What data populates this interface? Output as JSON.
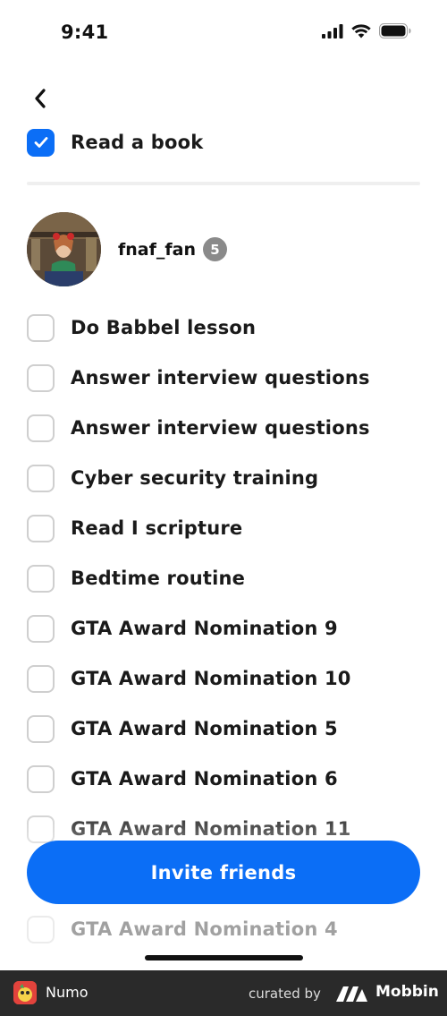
{
  "status_bar": {
    "time": "9:41"
  },
  "completed_task": {
    "label": "Read a book"
  },
  "user": {
    "name": "fnaf_fan",
    "badge": "5"
  },
  "tasks": [
    "Do Babbel lesson",
    "Answer interview questions",
    "Answer interview questions",
    "Cyber security training",
    "Read I scripture",
    "Bedtime routine",
    "GTA Award Nomination 9",
    "GTA Award Nomination 10",
    "GTA Award Nomination 5",
    "GTA Award Nomination 6",
    "GTA Award Nomination 11",
    "GTA Award Nomination 4"
  ],
  "invite_button": {
    "label": "Invite friends"
  },
  "footer": {
    "app_name": "Numo",
    "curated_by": "curated by",
    "brand": "Mobbin"
  },
  "colors": {
    "accent": "#0b6ef6",
    "footer_bg": "#2a2a2a"
  },
  "icons": {
    "back": "chevron-left-icon",
    "check": "checkmark-icon"
  }
}
